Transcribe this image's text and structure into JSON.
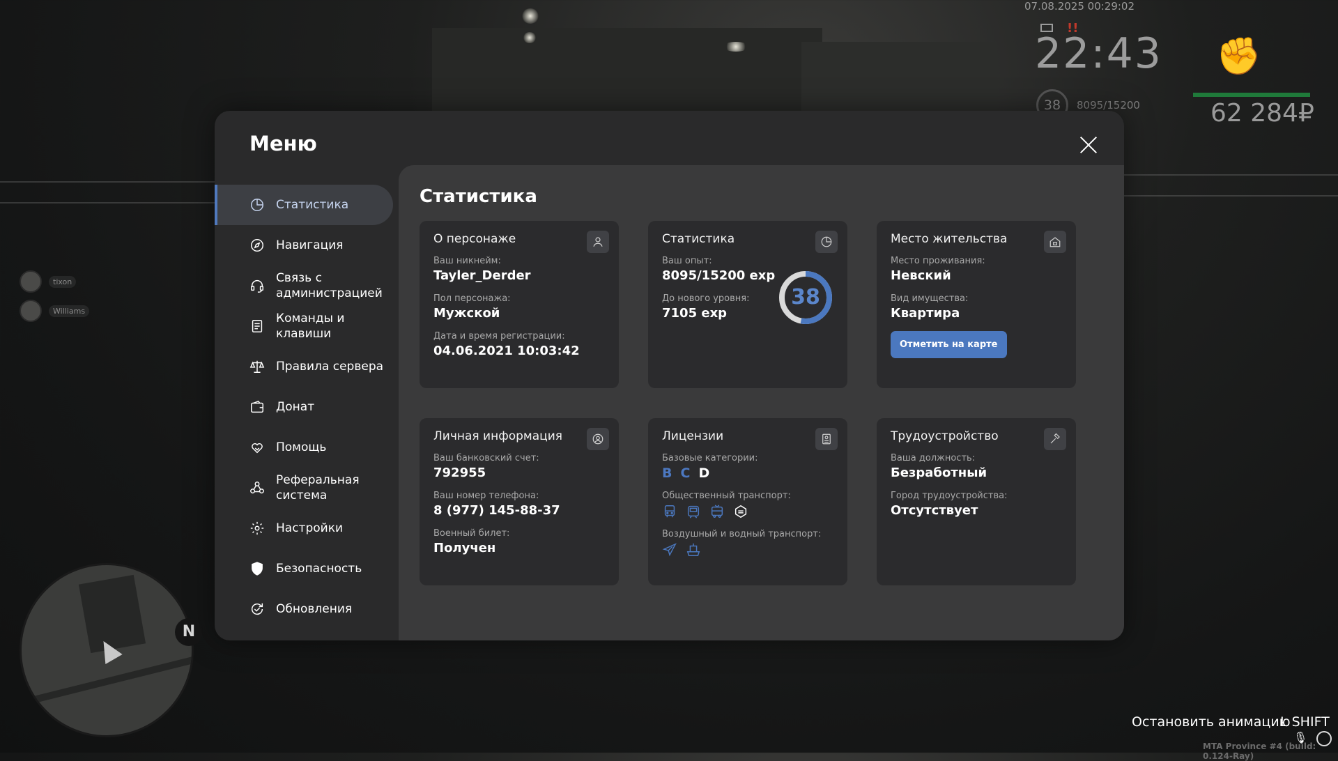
{
  "hud": {
    "datetime": "07.08.2025 00:29:02",
    "clock": "22:43",
    "level": "38",
    "exp": "8095/15200",
    "money": "62 284₽",
    "warning": "!!"
  },
  "players": [
    {
      "name": "tixon"
    },
    {
      "name": "Williams"
    }
  ],
  "minimap": {
    "north": "N"
  },
  "hints": {
    "stop_animation": "Остановить анимацию",
    "stop_key": "L SHIFT",
    "build": "MTA Province #4 (build: 0.124-Ray)"
  },
  "menu": {
    "title": "Меню",
    "content_title": "Статистика",
    "sidebar": [
      {
        "label": "Статистика",
        "icon": "pie-chart-icon",
        "active": true
      },
      {
        "label": "Навигация",
        "icon": "compass-icon"
      },
      {
        "label": "Связь с\nадминистрацией",
        "icon": "headset-icon"
      },
      {
        "label": "Команды и\nклавиши",
        "icon": "document-list-icon"
      },
      {
        "label": "Правила сервера",
        "icon": "scales-icon"
      },
      {
        "label": "Донат",
        "icon": "wallet-icon"
      },
      {
        "label": "Помощь",
        "icon": "heart-hands-icon"
      },
      {
        "label": "Реферальная\nсистема",
        "icon": "people-network-icon"
      },
      {
        "label": "Настройки",
        "icon": "gear-icon"
      },
      {
        "label": "Безопасность",
        "icon": "shield-icon"
      },
      {
        "label": "Обновления",
        "icon": "refresh-check-icon"
      }
    ]
  },
  "cards": {
    "character": {
      "title": "О персонаже",
      "icon": "person-icon",
      "nick_label": "Ваш никнейм:",
      "nick": "Tayler_Derder",
      "gender_label": "Пол персонажа:",
      "gender": "Мужской",
      "reg_label": "Дата и время регистрации:",
      "reg": "04.06.2021 10:03:42"
    },
    "stats": {
      "title": "Статистика",
      "icon": "pie-chart-icon",
      "exp_label": "Ваш опыт:",
      "exp": "8095/15200 exp",
      "next_label": "До нового уровня:",
      "next": "7105 exp",
      "level": "38",
      "level_progress": 0.53
    },
    "residence": {
      "title": "Место жительства",
      "icon": "house-icon",
      "place_label": "Место проживания:",
      "place": "Невский",
      "property_label": "Вид имущества:",
      "property": "Квартира",
      "button": "Отметить на карте"
    },
    "personal": {
      "title": "Личная информация",
      "icon": "user-circle-icon",
      "bank_label": "Ваш банковский счет:",
      "bank": "792955",
      "phone_label": "Ваш номер телефона:",
      "phone": "8 (977) 145-88-37",
      "military_label": "Военный билет:",
      "military": "Получен"
    },
    "licenses": {
      "title": "Лицензии",
      "icon": "id-card-icon",
      "base_label": "Базовые категории:",
      "categories": [
        "B",
        "C",
        "D"
      ],
      "public_label": "Общественный транспорт:",
      "public_icons": [
        "bus-icon",
        "tram-icon",
        "trolleybus-icon",
        "train-icon"
      ],
      "air_label": "Воздушный и водный транспорт:",
      "air_icons": [
        "plane-icon",
        "boat-icon"
      ]
    },
    "job": {
      "title": "Трудоустройство",
      "icon": "hammer-icon",
      "position_label": "Ваша должность:",
      "position": "Безработный",
      "city_label": "Город трудоустройства:",
      "city": "Отсутствует"
    }
  },
  "colors": {
    "accent": "#4b78bf",
    "panel": "#2a2a2b",
    "content": "#3a3a3b",
    "card": "#2b2b2d",
    "health": "#1f7a3a"
  }
}
